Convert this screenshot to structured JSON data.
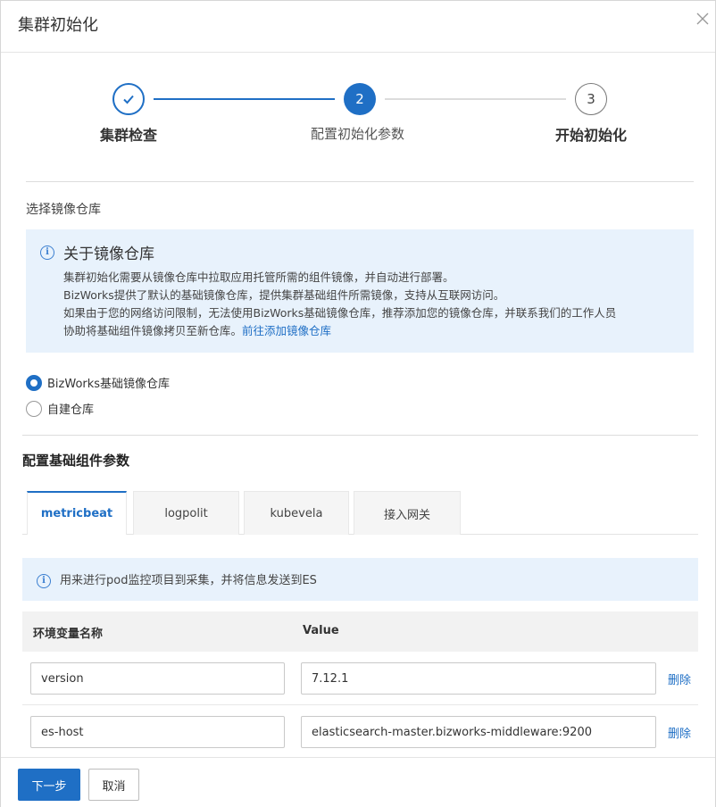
{
  "dialog": {
    "title": "集群初始化",
    "close_icon": "close-icon"
  },
  "steps": [
    {
      "number": "1",
      "label": "集群检查",
      "status": "done"
    },
    {
      "number": "2",
      "label": "配置初始化参数",
      "status": "current"
    },
    {
      "number": "3",
      "label": "开始初始化",
      "status": "pending"
    }
  ],
  "registry": {
    "section_label": "选择镜像仓库",
    "info": {
      "title": "关于镜像仓库",
      "lines": [
        "集群初始化需要从镜像仓库中拉取应用托管所需的组件镜像，并自动进行部署。",
        "BizWorks提供了默认的基础镜像仓库，提供集群基础组件所需镜像，支持从互联网访问。",
        "如果由于您的网络访问限制，无法使用BizWorks基础镜像仓库，推荐添加您的镜像仓库，并联系我们的工作人员",
        "协助将基础组件镜像拷贝至新仓库。"
      ],
      "link": "前往添加镜像仓库"
    },
    "options": [
      {
        "label": "BizWorks基础镜像仓库",
        "selected": true
      },
      {
        "label": "自建仓库",
        "selected": false
      }
    ]
  },
  "components": {
    "title": "配置基础组件参数",
    "tabs": [
      {
        "label": "metricbeat",
        "active": true
      },
      {
        "label": "logpolit",
        "active": false
      },
      {
        "label": "kubevela",
        "active": false
      },
      {
        "label": "接入网关",
        "active": false
      }
    ],
    "hint": "用来进行pod监控项目到采集，并将信息发送到ES",
    "table": {
      "headers": [
        "环境变量名称",
        "Value"
      ],
      "rows": [
        {
          "name": "version",
          "value": "7.12.1",
          "action": "删除"
        },
        {
          "name": "es-host",
          "value": "elasticsearch-master.bizworks-middleware:9200",
          "action": "删除"
        }
      ]
    }
  },
  "footer": {
    "next_label": "下一步",
    "cancel_label": "取消"
  },
  "colors": {
    "accent": "#1f6fc5",
    "info_bg": "#e8f2fc"
  }
}
